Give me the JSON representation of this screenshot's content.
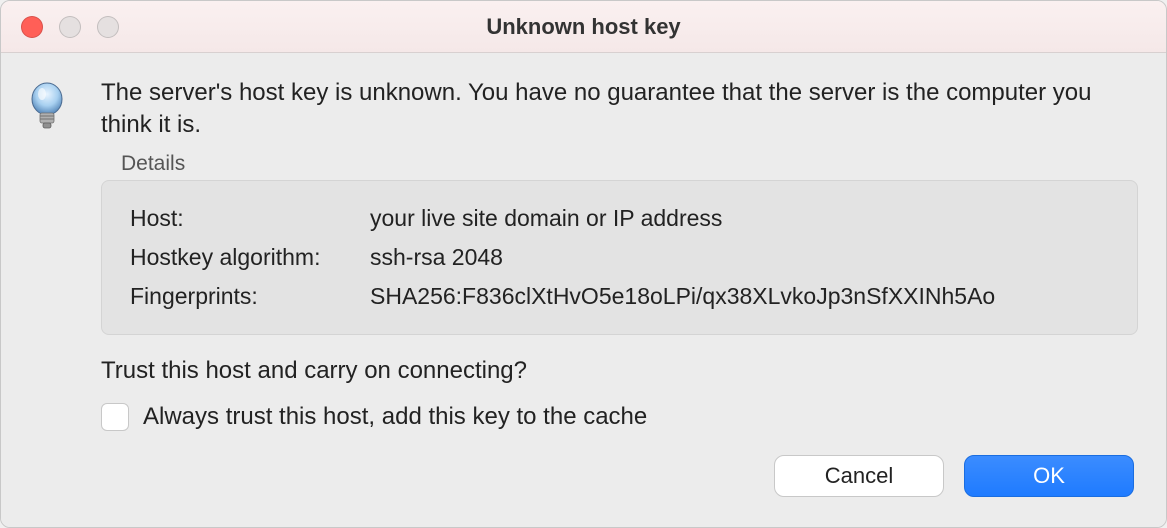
{
  "window": {
    "title": "Unknown host key"
  },
  "message": "The server's host key is unknown. You have no guarantee that the server is the computer you think it is.",
  "details": {
    "label": "Details",
    "rows": [
      {
        "key": "Host:",
        "value": "your live site domain or IP address"
      },
      {
        "key": "Hostkey algorithm:",
        "value": "ssh-rsa 2048"
      },
      {
        "key": "Fingerprints:",
        "value": "SHA256:F836clXtHvO5e18oLPi/qx38XLvkoJp3nSfXXINh5Ao"
      }
    ]
  },
  "trust_question": "Trust this host and carry on connecting?",
  "checkbox_label": "Always trust this host, add this key to the cache",
  "buttons": {
    "cancel": "Cancel",
    "ok": "OK"
  }
}
